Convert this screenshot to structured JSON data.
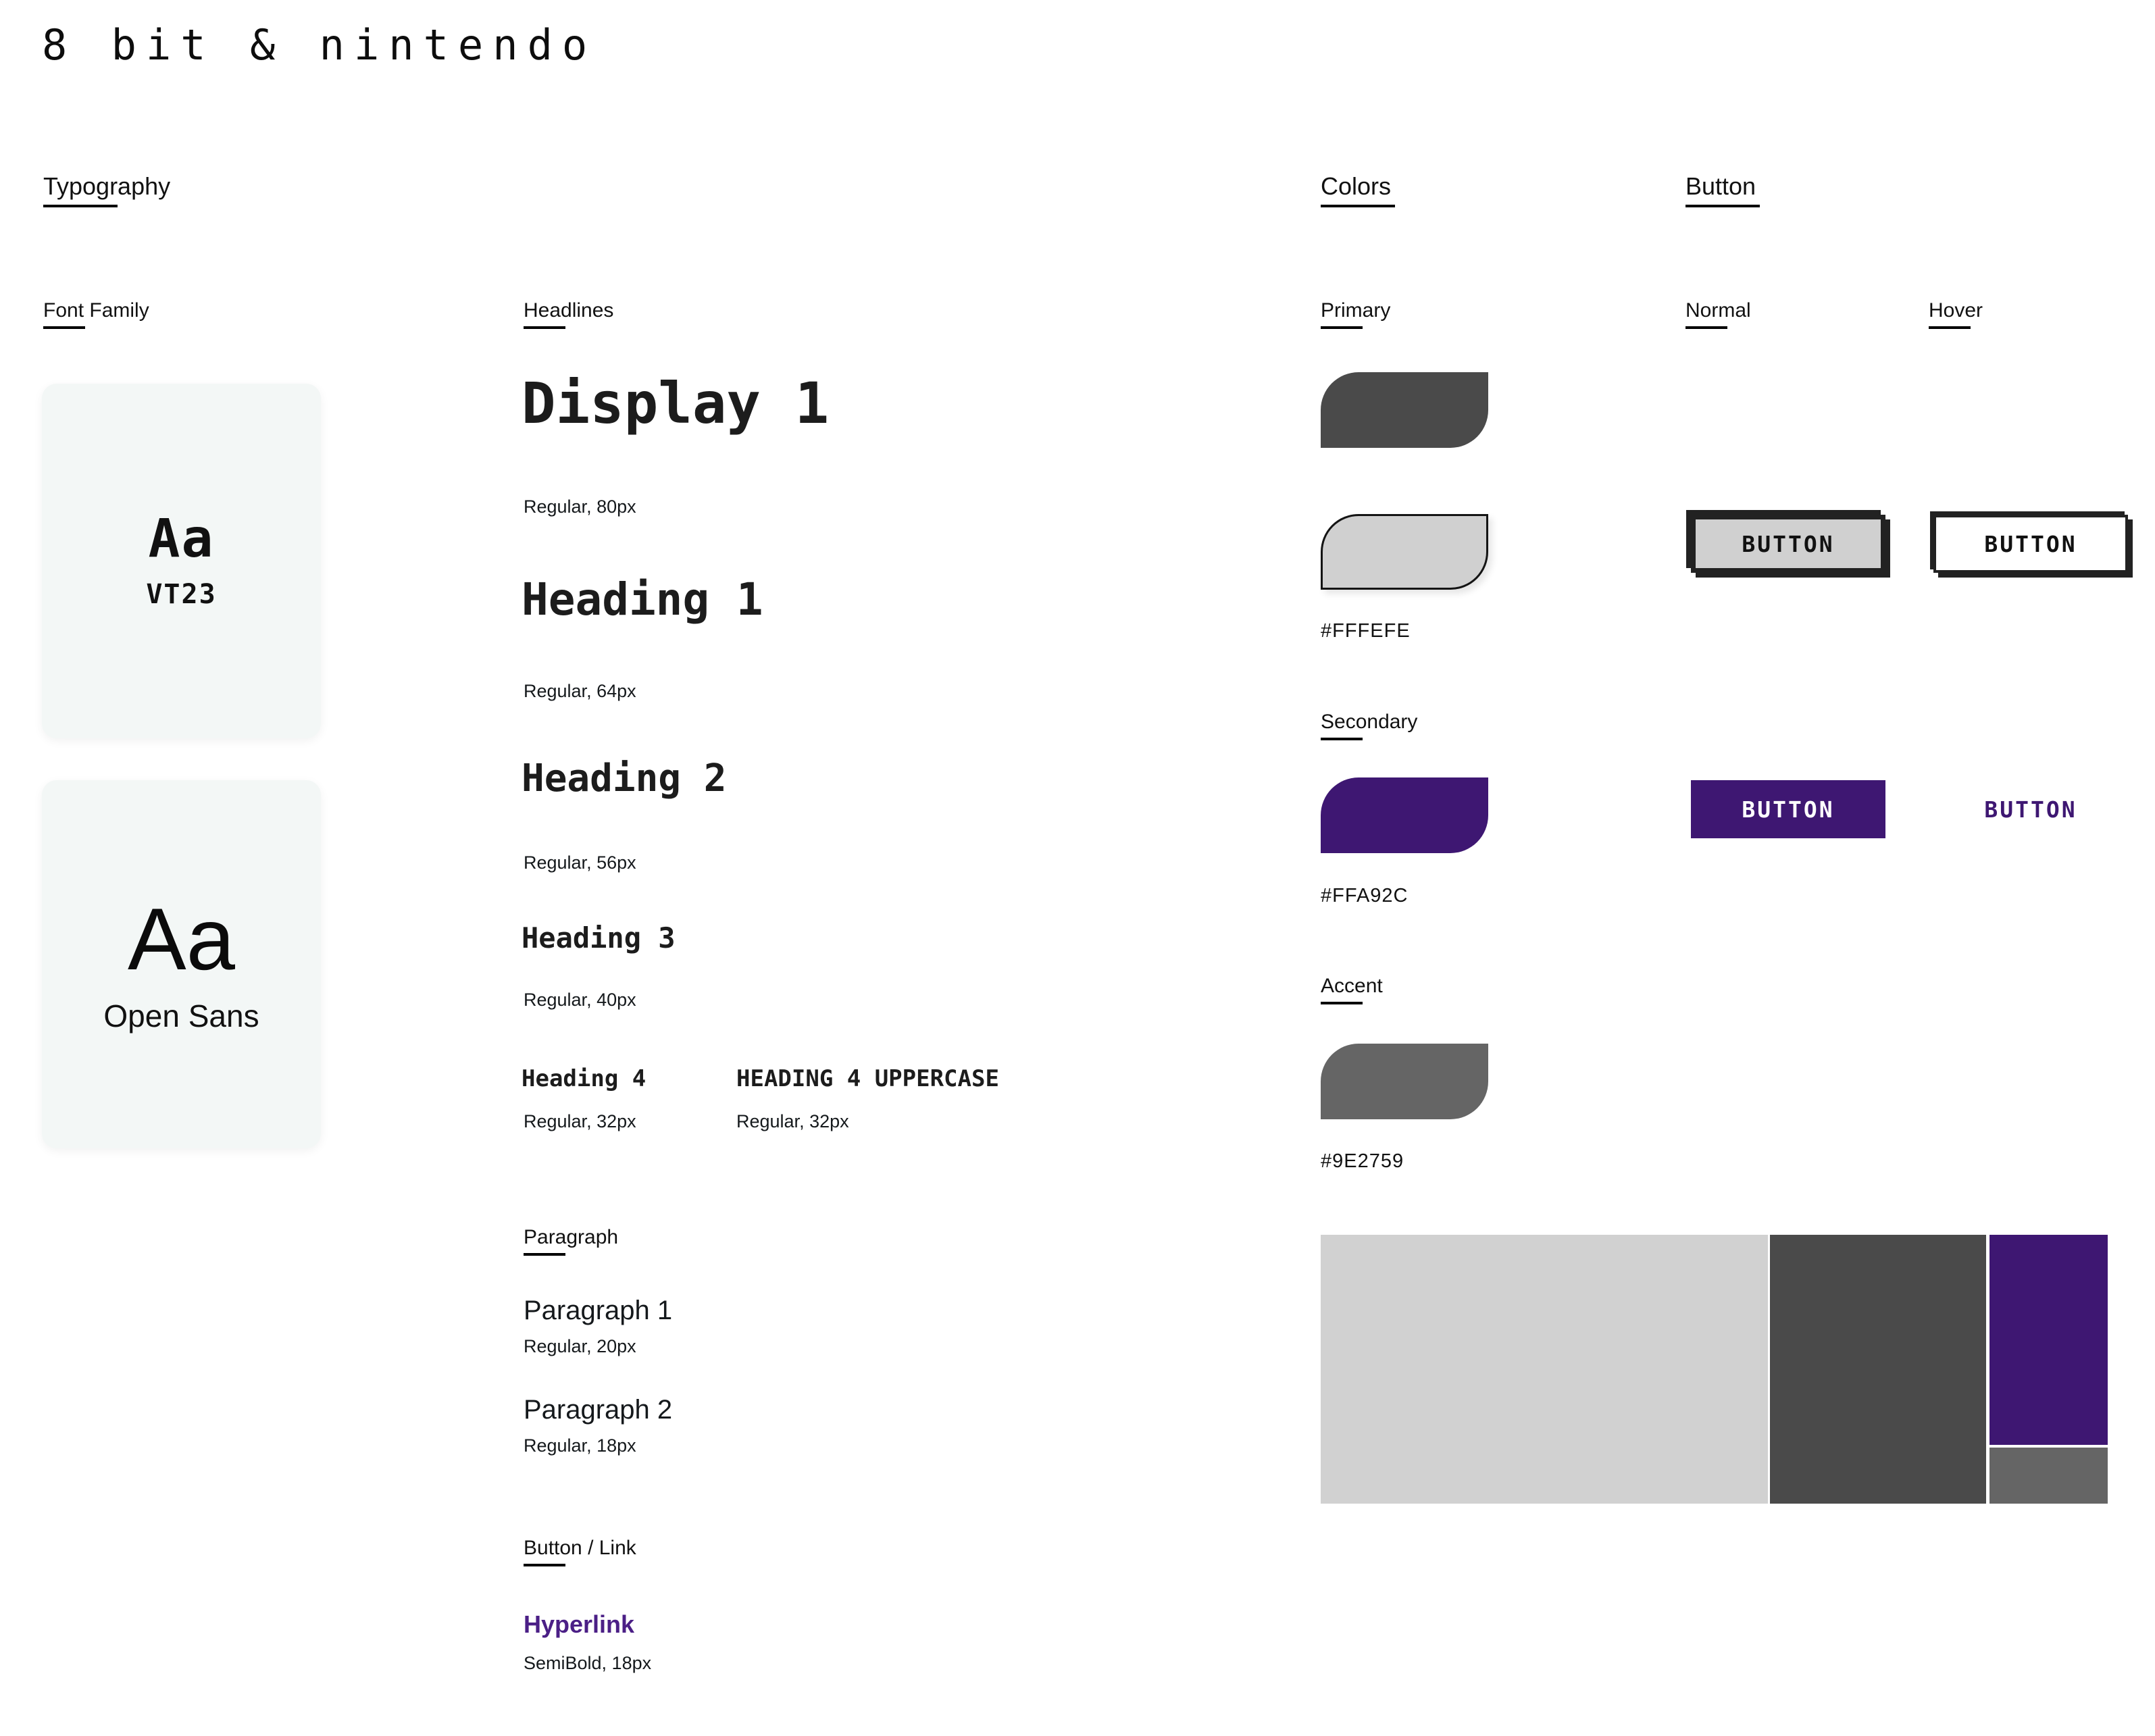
{
  "page": {
    "title": "8 bit & nintendo"
  },
  "sections": {
    "typography": "Typography",
    "colors": "Colors",
    "button": "Button"
  },
  "typography": {
    "font_family_label": "Font Family",
    "cards": [
      {
        "glyph": "Aa",
        "name": "VT23"
      },
      {
        "glyph": "Aa",
        "name": "Open Sans"
      }
    ],
    "headlines_label": "Headlines",
    "headlines": [
      {
        "sample": "Display 1",
        "spec": "Regular, 80px"
      },
      {
        "sample": "Heading 1",
        "spec": "Regular, 64px"
      },
      {
        "sample": "Heading 2",
        "spec": "Regular, 56px"
      },
      {
        "sample": "Heading 3",
        "spec": "Regular, 40px"
      },
      {
        "sample": "Heading 4",
        "spec": "Regular, 32px"
      },
      {
        "sample": "HEADING 4 UPPERCASE",
        "spec": "Regular, 32px"
      }
    ],
    "paragraph_label": "Paragraph",
    "paragraphs": [
      {
        "sample": "Paragraph 1",
        "spec": "Regular, 20px"
      },
      {
        "sample": "Paragraph 2",
        "spec": "Regular, 18px"
      }
    ],
    "button_link_label": "Button / Link",
    "link": {
      "sample": "Hyperlink",
      "spec": "SemiBold, 18px",
      "color": "#4B1F86"
    }
  },
  "colors": {
    "groups": [
      {
        "label": "Primary",
        "swatches": [
          {
            "fill": "#4a4a4a",
            "outlined": false,
            "hex": ""
          },
          {
            "fill": "#d0d0d0",
            "outlined": true,
            "hex": "#FFFEFE"
          }
        ]
      },
      {
        "label": "Secondary",
        "swatches": [
          {
            "fill": "#3E1772",
            "outlined": false,
            "hex": "#FFA92C"
          }
        ]
      },
      {
        "label": "Accent",
        "swatches": [
          {
            "fill": "#656565",
            "outlined": false,
            "hex": "#9E2759"
          }
        ]
      }
    ],
    "palette_blocks": [
      {
        "fill": "#d1d1d1"
      },
      {
        "fill": "#4a4a4a"
      },
      {
        "fill": "#3E1772"
      },
      {
        "fill": "#656565"
      }
    ]
  },
  "buttons": {
    "normal_label": "Normal",
    "hover_label": "Hover",
    "primary": {
      "normal_text": "BUTTON",
      "hover_text": "BUTTON"
    },
    "secondary": {
      "normal_text": "BUTTON",
      "hover_text": "BUTTON",
      "fill": "#3E1772",
      "text_color": "#3E1772"
    }
  }
}
